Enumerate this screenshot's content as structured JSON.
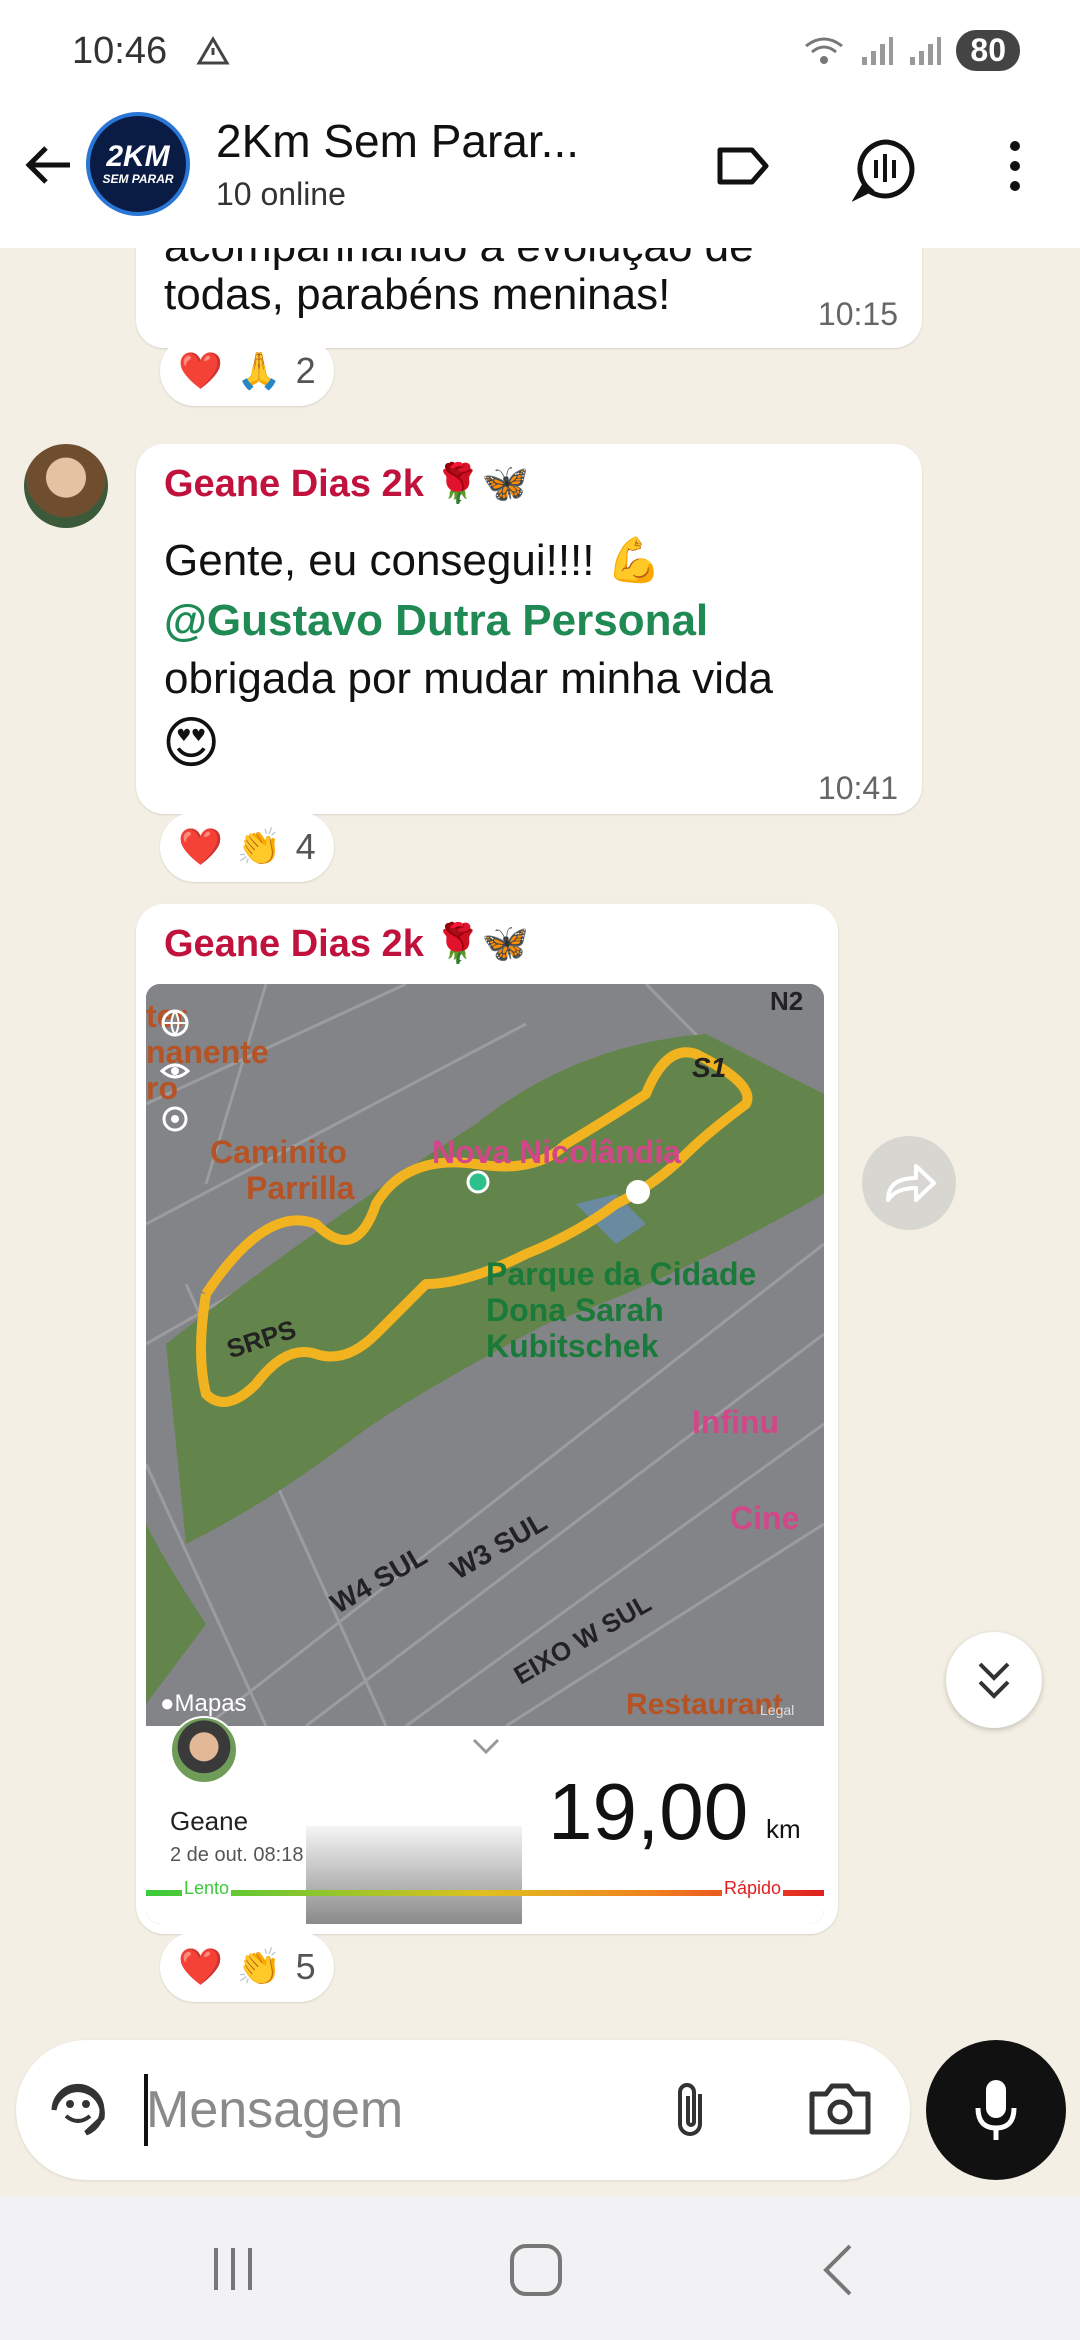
{
  "status": {
    "time": "10:46",
    "battery": "80"
  },
  "header": {
    "avatar_line1": "2KM",
    "avatar_line2": "SEM PARAR",
    "title": "2Km Sem Parar...",
    "subtitle": "10 online"
  },
  "messages": {
    "m1": {
      "text_partial": "acompanhando a evolução de",
      "text": "todas, parabéns meninas!",
      "time": "10:15",
      "react_count": "2"
    },
    "m2": {
      "sender": "Geane Dias 2k 🌹🦋",
      "line1": "Gente, eu consegui!!!! 💪",
      "mention": "@Gustavo Dutra Personal",
      "line3": "obrigada por mudar minha vida",
      "emoji": "😍",
      "time": "10:41",
      "react_count": "4"
    },
    "m3": {
      "sender": "Geane Dias 2k 🌹🦋",
      "react_count": "5"
    }
  },
  "map": {
    "labels": {
      "n2": "N2",
      "s1": "S1",
      "nova": "Nova Nicolândia",
      "caminito1": "Caminito",
      "caminito2": "Parrilla",
      "parque1": "Parque da Cidade",
      "parque2": "Dona Sarah",
      "parque3": "Kubitschek",
      "srps": "SRPS",
      "infinu": "Infinu",
      "cine": "Cine",
      "w4": "W4 SUL",
      "w3": "W3 SUL",
      "eixo": "EIXO W SUL",
      "restaurant": "Restaurant",
      "legal": "Legal",
      "apple": "Mapas",
      "left1": "ter",
      "left2": "nanente",
      "left3": "ro"
    },
    "user": "Geane",
    "date": "2 de out. 08:18",
    "distance": "19,00",
    "unit": "km",
    "slow": "Lento",
    "fast": "Rápido"
  },
  "input": {
    "placeholder": "Mensagem"
  },
  "colors": {
    "sender": "#c0123c",
    "mention": "#1f8a53",
    "accent_route": "#f0a000"
  }
}
